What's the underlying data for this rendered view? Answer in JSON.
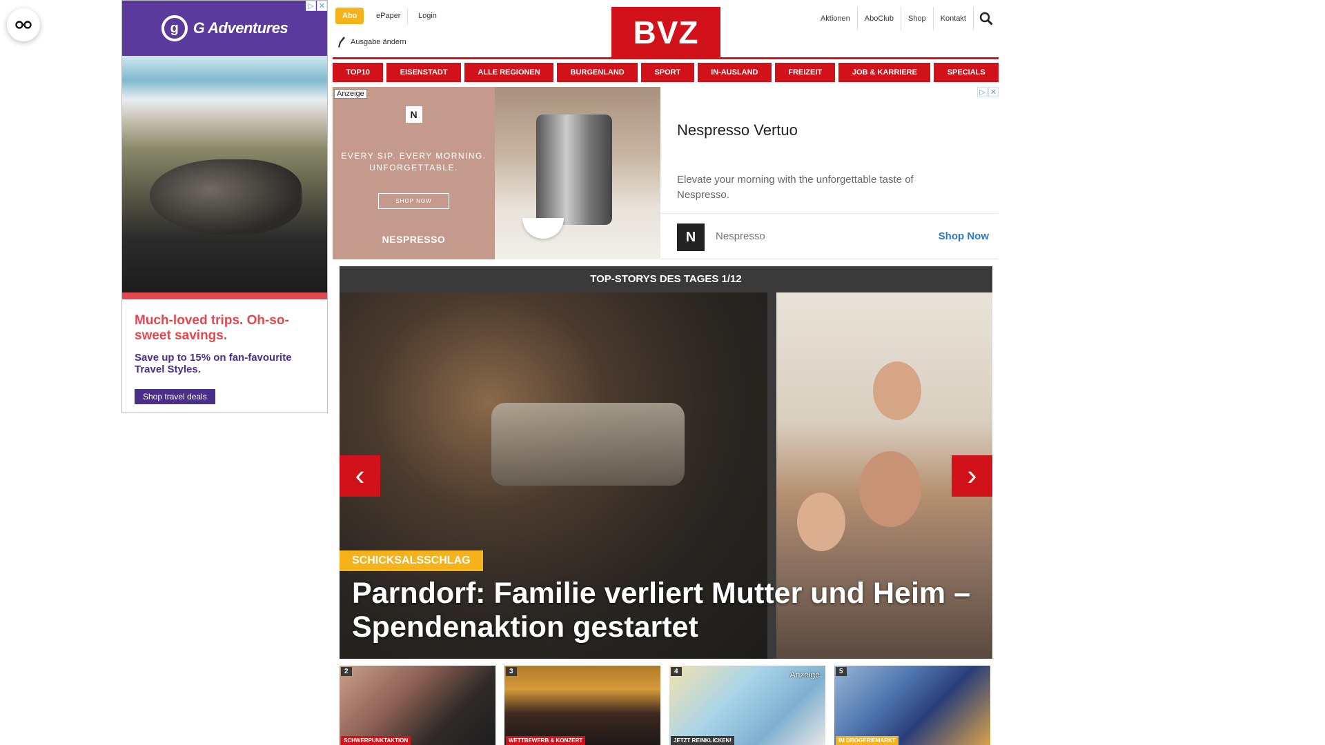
{
  "accessibility": {
    "icon": "accessibility-glasses-icon"
  },
  "side_ad": {
    "brand": "G Adventures",
    "logo_letter": "g",
    "headline": "Much-loved trips. Oh-so-sweet savings.",
    "subline": "Save up to 15% on fan-favourite Travel Styles.",
    "cta": "Shop travel deals",
    "adchoices": [
      "▷",
      "✕"
    ]
  },
  "header": {
    "abo": "Abo",
    "epaper": "ePaper",
    "login": "Login",
    "ausgabe": "Ausgabe ändern",
    "logo": "BVZ",
    "right_links": [
      "Aktionen",
      "AboClub",
      "Shop",
      "Kontakt"
    ]
  },
  "categories": [
    "TOP10",
    "EISENSTADT",
    "ALLE REGIONEN",
    "BURGENLAND",
    "SPORT",
    "IN-AUSLAND",
    "FREIZEIT",
    "JOB & KARRIERE",
    "SPECIALS"
  ],
  "nespresso_ad": {
    "anzeige": "Anzeige",
    "banner_mark": "N",
    "banner_copy": "EVERY SIP. EVERY MORNING. UNFORGETTABLE.",
    "banner_shop": "SHOP NOW",
    "banner_brand": "NESPRESSO",
    "title": "Nespresso Vertuo",
    "description": "Elevate your morning with the unforgettable taste of Nespresso.",
    "logo_letter": "N",
    "advertiser": "Nespresso",
    "cta": "Shop Now"
  },
  "top_stories": {
    "heading": "TOP-STORYS DES TAGES 1/12",
    "tag": "SCHICKSALSSCHLAG",
    "headline": "Parndorf: Familie verliert Mutter und Heim – Spendenaktion gestartet",
    "prev": "‹",
    "next": "›"
  },
  "thumbnails": [
    {
      "num": "2",
      "label": "SCHWERPUNKTAKTION",
      "anzeige": ""
    },
    {
      "num": "3",
      "label": "WETTBEWERB & KONZERT",
      "anzeige": ""
    },
    {
      "num": "4",
      "label": "JETZT REINKLICKEN!",
      "anzeige": "Anzeige"
    },
    {
      "num": "5",
      "label": "IM DROGERIEMARKT",
      "anzeige": ""
    }
  ],
  "colors": {
    "brand_red": "#d2121b",
    "accent_yellow": "#f5b21b",
    "dark_bar": "#3a3a3a",
    "ad_purple": "#4a2f8a",
    "ad_coral": "#e4484f"
  }
}
